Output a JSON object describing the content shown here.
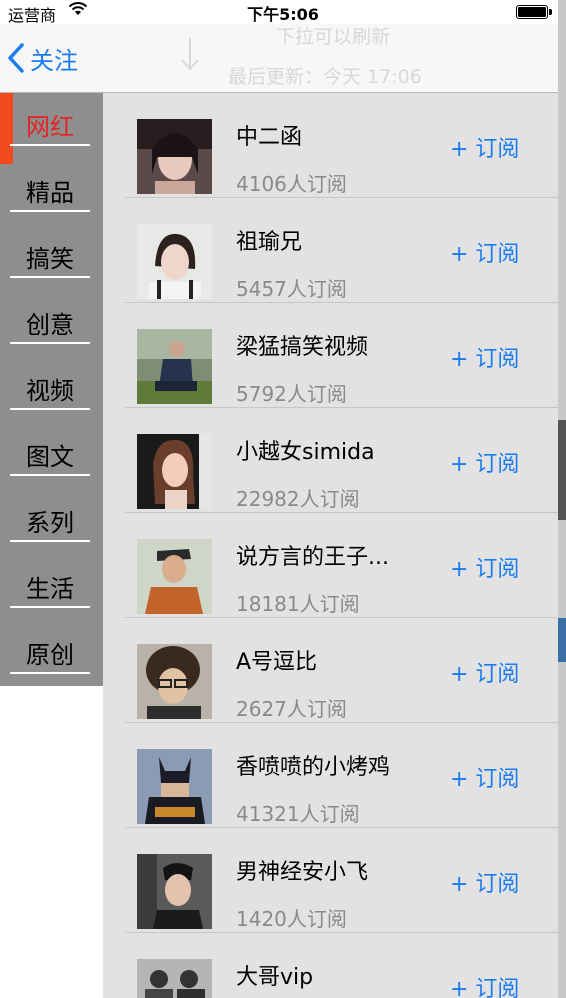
{
  "status_bar": {
    "carrier": "运营商",
    "time": "下午5:06"
  },
  "nav": {
    "back_label": "关注",
    "pull_hint": "下拉可以刷新",
    "last_updated": "最后更新：今天 17:06"
  },
  "categories": [
    {
      "label": "网红",
      "active": true
    },
    {
      "label": "精品",
      "active": false
    },
    {
      "label": "搞笑",
      "active": false
    },
    {
      "label": "创意",
      "active": false
    },
    {
      "label": "视频",
      "active": false
    },
    {
      "label": "图文",
      "active": false
    },
    {
      "label": "系列",
      "active": false
    },
    {
      "label": "生活",
      "active": false
    },
    {
      "label": "原创",
      "active": false
    }
  ],
  "subscribe_label": "+ 订阅",
  "users": [
    {
      "name": "中二函",
      "subscribers": "4106人订阅"
    },
    {
      "name": "祖瑜兄",
      "subscribers": "5457人订阅"
    },
    {
      "name": "梁猛搞笑视频",
      "subscribers": "5792人订阅"
    },
    {
      "name": "小越女simida",
      "subscribers": "22982人订阅"
    },
    {
      "name": "说方言的王子...",
      "subscribers": "18181人订阅"
    },
    {
      "name": "A号逗比",
      "subscribers": "2627人订阅"
    },
    {
      "name": "香喷喷的小烤鸡",
      "subscribers": "41321人订阅"
    },
    {
      "name": "男神经安小飞",
      "subscribers": "1420人订阅"
    },
    {
      "name": "大哥vip",
      "subscribers": ""
    }
  ],
  "colors": {
    "accent": "#1a7cf0",
    "active_category": "#e32424",
    "indicator": "#f04a1d"
  }
}
